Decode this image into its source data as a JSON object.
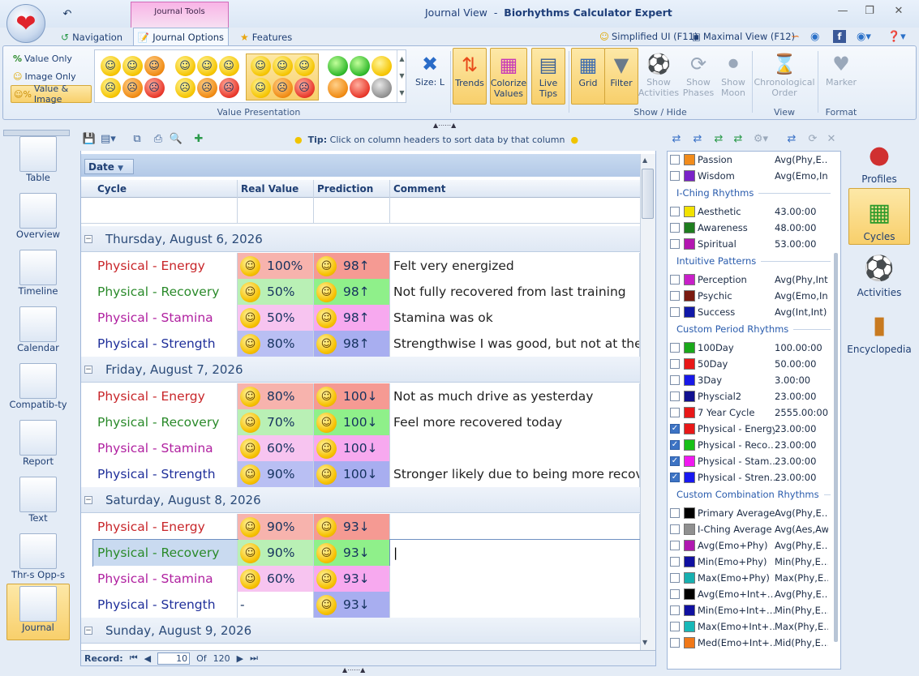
{
  "app": {
    "title_view": "Journal View",
    "title_sep": "-",
    "title_name": "Biorhythms Calculator Expert",
    "context_tab": "Journal Tools"
  },
  "tabs": [
    {
      "label": "Navigation"
    },
    {
      "label": "Journal Options"
    },
    {
      "label": "Features"
    }
  ],
  "right_links": {
    "simplified": "Simplified UI (F11)",
    "maximal": "Maximal View (F12)"
  },
  "ribbon": {
    "value_presentation": {
      "label": "Value Presentation",
      "opt_value": "Value Only",
      "opt_image": "Image Only",
      "opt_both": "Value & Image",
      "size_label": "Size: L"
    },
    "buttons": {
      "trends": "Trends",
      "colorize": "Colorize Values",
      "live": "Live Tips",
      "grid": "Grid",
      "filter": "Filter",
      "show_activities": "Show Activities",
      "show_phases": "Show Phases",
      "show_moon": "Show Moon",
      "chrono": "Chronological Order",
      "marker": "Marker"
    },
    "groups": {
      "show_hide": "Show / Hide",
      "view": "View",
      "format": "Format"
    }
  },
  "leftnav": [
    "Table",
    "Overview",
    "Timeline",
    "Calendar",
    "Compatib-ty",
    "Report",
    "Text",
    "Thr-s Opp-s",
    "Journal"
  ],
  "toolbar": {
    "tip_bold": "Tip:",
    "tip_text": "Click on column headers to sort data by that column"
  },
  "grid": {
    "group_by": "Date",
    "columns": [
      "Cycle",
      "Real Value",
      "Prediction",
      "Comment"
    ],
    "groups": [
      {
        "date": "Thursday, August 6, 2026",
        "rows": [
          {
            "cycle": "Physical - Energy",
            "real": "100%",
            "pred": "98↑",
            "comment": "Felt very energized"
          },
          {
            "cycle": "Physical - Recovery",
            "real": "50%",
            "pred": "98↑",
            "comment": "Not fully recovered from last training"
          },
          {
            "cycle": "Physical - Stamina",
            "real": "50%",
            "pred": "98↑",
            "comment": "Stamina was ok"
          },
          {
            "cycle": "Physical - Strength",
            "real": "80%",
            "pred": "98↑",
            "comment": "Strengthwise I was good, but not at the…"
          }
        ]
      },
      {
        "date": "Friday, August 7, 2026",
        "rows": [
          {
            "cycle": "Physical - Energy",
            "real": "80%",
            "pred": "100↓",
            "comment": "Not as much drive as yesterday"
          },
          {
            "cycle": "Physical - Recovery",
            "real": "70%",
            "pred": "100↓",
            "comment": "Feel more recovered today"
          },
          {
            "cycle": "Physical - Stamina",
            "real": "60%",
            "pred": "100↓",
            "comment": ""
          },
          {
            "cycle": "Physical - Strength",
            "real": "90%",
            "pred": "100↓",
            "comment": "Stronger likely due to being more recov…"
          }
        ]
      },
      {
        "date": "Saturday, August 8, 2026",
        "rows": [
          {
            "cycle": "Physical - Energy",
            "real": "90%",
            "pred": "93↓",
            "comment": ""
          },
          {
            "cycle": "Physical - Recovery",
            "real": "90%",
            "pred": "93↓",
            "comment": ""
          },
          {
            "cycle": "Physical - Stamina",
            "real": "60%",
            "pred": "93↓",
            "comment": ""
          },
          {
            "cycle": "Physical - Strength",
            "real": "-",
            "pred": "93↓",
            "comment": ""
          }
        ]
      },
      {
        "date": "Sunday, August 9, 2026",
        "rows": []
      }
    ]
  },
  "record_bar": {
    "label": "Record:",
    "current": "10",
    "of_label": "Of",
    "total": "120"
  },
  "rhythms": [
    {
      "type": "item",
      "name": "Passion",
      "value": "Avg(Phy,E…",
      "color": "#f28c1c",
      "checked": false
    },
    {
      "type": "item",
      "name": "Wisdom",
      "value": "Avg(Emo,In",
      "color": "#7a22c8",
      "checked": false
    },
    {
      "type": "section",
      "name": "I-Ching Rhythms"
    },
    {
      "type": "item",
      "name": "Aesthetic",
      "value": "43.00:00",
      "color": "#f2e200",
      "checked": false
    },
    {
      "type": "item",
      "name": "Awareness",
      "value": "48.00:00",
      "color": "#1e7d1e",
      "checked": false
    },
    {
      "type": "item",
      "name": "Spiritual",
      "value": "53.00:00",
      "color": "#b316b0",
      "checked": false
    },
    {
      "type": "section",
      "name": "Intuitive Patterns"
    },
    {
      "type": "item",
      "name": "Perception",
      "value": "Avg(Phy,Int",
      "color": "#c81fc8",
      "checked": false
    },
    {
      "type": "item",
      "name": "Psychic",
      "value": "Avg(Emo,In",
      "color": "#7a1a10",
      "checked": false
    },
    {
      "type": "item",
      "name": "Success",
      "value": "Avg(Int,Int)",
      "color": "#1018a8",
      "checked": false
    },
    {
      "type": "section",
      "name": "Custom Period Rhythms"
    },
    {
      "type": "item",
      "name": "100Day",
      "value": "100.00:00",
      "color": "#1aa81a",
      "checked": false
    },
    {
      "type": "item",
      "name": "50Day",
      "value": "50.00:00",
      "color": "#e81818",
      "checked": false
    },
    {
      "type": "item",
      "name": "3Day",
      "value": "3.00:00",
      "color": "#1818e8",
      "checked": false
    },
    {
      "type": "item",
      "name": "Physcial2",
      "value": "23.00:00",
      "color": "#101090",
      "checked": false
    },
    {
      "type": "item",
      "name": "7 Year Cycle",
      "value": "2555.00:00",
      "color": "#e81818",
      "checked": false
    },
    {
      "type": "item",
      "name": "Physical - Energy",
      "value": "23.00:00",
      "color": "#e81818",
      "checked": true
    },
    {
      "type": "item",
      "name": "Physical - Reco…",
      "value": "23.00:00",
      "color": "#18c018",
      "checked": true
    },
    {
      "type": "item",
      "name": "Physical - Stam…",
      "value": "23.00:00",
      "color": "#f018f0",
      "checked": true
    },
    {
      "type": "item",
      "name": "Physical - Stren…",
      "value": "23.00:00",
      "color": "#1818f0",
      "checked": true
    },
    {
      "type": "section",
      "name": "Custom Combination Rhythms"
    },
    {
      "type": "item",
      "name": "Primary Average",
      "value": "Avg(Phy,E…",
      "color": "#000000",
      "checked": false
    },
    {
      "type": "item",
      "name": "I-Ching Average",
      "value": "Avg(Aes,Aw",
      "color": "#909090",
      "checked": false
    },
    {
      "type": "item",
      "name": "Avg(Emo+Phy)",
      "value": "Avg(Phy,E…",
      "color": "#b018b0",
      "checked": false
    },
    {
      "type": "item",
      "name": "Min(Emo+Phy)",
      "value": "Min(Phy,E…",
      "color": "#1010a0",
      "checked": false
    },
    {
      "type": "item",
      "name": "Max(Emo+Phy)",
      "value": "Max(Phy,E…",
      "color": "#18b0b0",
      "checked": false
    },
    {
      "type": "item",
      "name": "Avg(Emo+Int+…",
      "value": "Avg(Phy,E…",
      "color": "#000000",
      "checked": false
    },
    {
      "type": "item",
      "name": "Min(Emo+Int+…",
      "value": "Min(Phy,E…",
      "color": "#1010a0",
      "checked": false
    },
    {
      "type": "item",
      "name": "Max(Emo+Int+…",
      "value": "Max(Phy,E…",
      "color": "#18b8b8",
      "checked": false
    },
    {
      "type": "item",
      "name": "Med(Emo+Int+…",
      "value": "Mid(Phy,E…",
      "color": "#f07818",
      "checked": false
    }
  ],
  "sidebar": [
    "Profiles",
    "Cycles",
    "Activities",
    "Encyclopedia"
  ],
  "colors": {
    "energy_bg": "#f7b3ad",
    "recovery_bg": "#b9f0b5",
    "stamina_bg": "#f7c4f0",
    "strength_bg": "#b9bff3",
    "energy_pred": "#f59a93",
    "recovery_pred": "#8ff08a",
    "stamina_pred": "#f7a9ef",
    "strength_pred": "#a8aef0"
  }
}
